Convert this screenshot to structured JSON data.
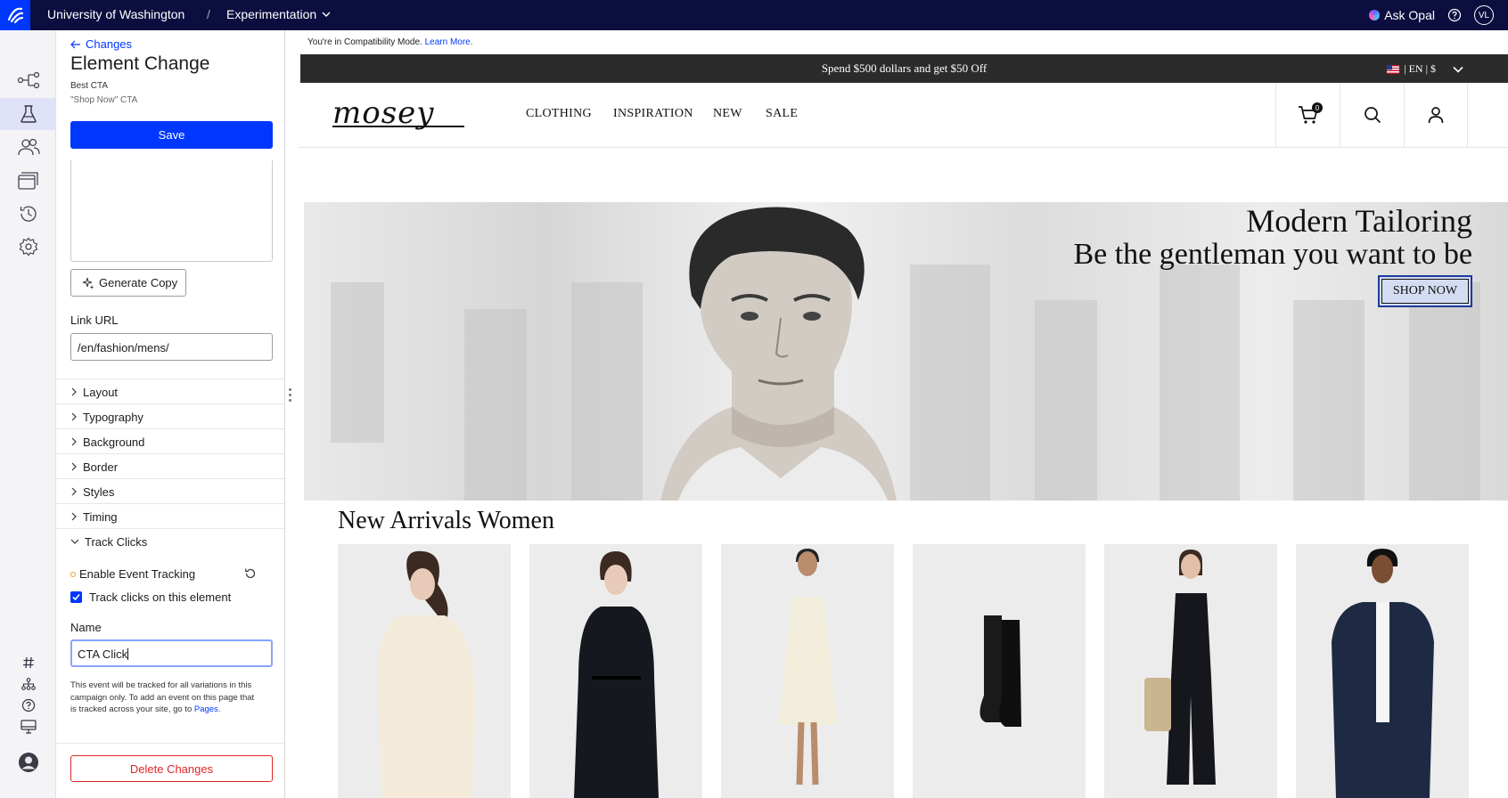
{
  "topbar": {
    "org": "University of Washington",
    "separator": "/",
    "section": "Experimentation",
    "ask_opal": "Ask Opal",
    "user_initials": "VL"
  },
  "panel": {
    "back_label": "Changes",
    "title": "Element Change",
    "subtitle_1": "Best CTA",
    "subtitle_2": "\"Shop Now\" CTA",
    "save_label": "Save",
    "generate_copy_label": "Generate Copy",
    "link_url_label": "Link URL",
    "link_url_value": "/en/fashion/mens/",
    "sections": [
      "Layout",
      "Typography",
      "Background",
      "Border",
      "Styles",
      "Timing",
      "Track Clicks"
    ],
    "enable_tracking_label": "Enable Event Tracking",
    "track_clicks_label": "Track clicks on this element",
    "track_clicks_checked": true,
    "name_label": "Name",
    "name_value": "CTA Click",
    "help_text": "This event will be tracked for all variations in this campaign only. To add an event on this page that is tracked across your site, go to",
    "help_link": "Pages",
    "help_end": ".",
    "delete_label": "Delete Changes"
  },
  "preview": {
    "compat_text": "You're in Compatibility Mode.",
    "compat_link": "Learn More.",
    "promo_text": "Spend $500 dollars and get $50 Off",
    "locale_text": "| EN | $",
    "brand": "mosey",
    "nav_items": [
      "CLOTHING",
      "INSPIRATION",
      "NEW",
      "SALE"
    ],
    "cart_count": "0",
    "hero_title": "Modern Tailoring",
    "hero_subtitle": "Be the gentleman you want to be",
    "hero_cta": "SHOP NOW",
    "section_title": "New Arrivals Women"
  },
  "colors": {
    "topbar": "#0b0e3f",
    "accent": "#0037ff",
    "danger": "#e02424",
    "promo_bar": "#2b2b2b"
  },
  "icons": {
    "rail": [
      "flows-icon",
      "experiments-icon",
      "audiences-icon",
      "layouts-icon",
      "history-icon",
      "settings-icon"
    ],
    "rail_bottom": [
      "hash-icon",
      "sitemap-icon",
      "help-icon",
      "monitor-icon",
      "user-avatar"
    ]
  }
}
